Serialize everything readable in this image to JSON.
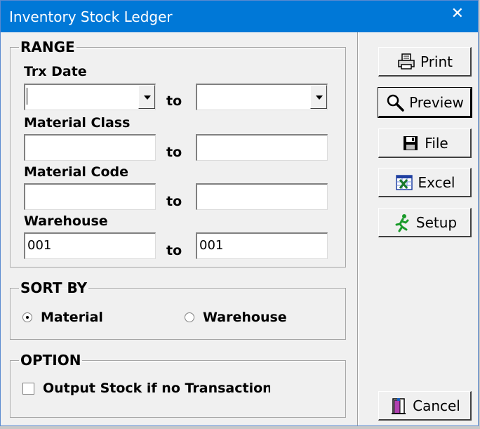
{
  "window": {
    "title": "Inventory Stock Ledger"
  },
  "range": {
    "legend": "RANGE",
    "to_label": "to",
    "trx_date": {
      "label": "Trx Date",
      "from_value": "",
      "to_value": ""
    },
    "material_class": {
      "label": "Material Class",
      "from_value": "",
      "to_value": ""
    },
    "material_code": {
      "label": "Material Code",
      "from_value": "",
      "to_value": ""
    },
    "warehouse": {
      "label": "Warehouse",
      "from_value": "001",
      "to_value": "001"
    }
  },
  "sort_by": {
    "legend": "SORT BY",
    "options": [
      {
        "label": "Material",
        "selected": true
      },
      {
        "label": "Warehouse",
        "selected": false
      }
    ]
  },
  "option": {
    "legend": "OPTION",
    "output_stock_label": "Output Stock if no Transaction",
    "output_stock_checked": false
  },
  "buttons": {
    "print": "Print",
    "preview": "Preview",
    "file": "File",
    "excel": "Excel",
    "setup": "Setup",
    "cancel": "Cancel"
  },
  "icons": {
    "close": "close-icon",
    "print": "printer-icon",
    "preview": "magnifier-icon",
    "file": "floppy-disk-icon",
    "excel": "excel-icon",
    "setup": "running-man-icon",
    "cancel": "door-exit-icon"
  }
}
